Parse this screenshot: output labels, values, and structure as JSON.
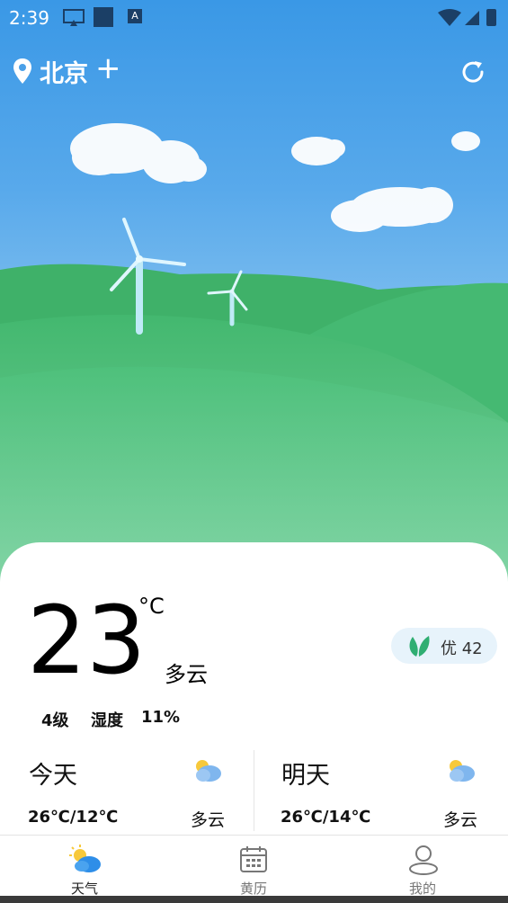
{
  "status_bar": {
    "time": "2:39"
  },
  "header": {
    "city": "北京",
    "add_symbol": "+"
  },
  "current": {
    "temperature": "23",
    "unit": "°C",
    "condition": "多云",
    "wind": "4级",
    "humidity_label": "湿度",
    "humidity_value": "11%",
    "aqi": "优 42"
  },
  "forecast": [
    {
      "day": "今天",
      "range": "26℃/12℃",
      "condition": "多云",
      "icon": "partly-cloudy-icon"
    },
    {
      "day": "明天",
      "range": "26℃/14℃",
      "condition": "多云",
      "icon": "partly-cloudy-icon"
    }
  ],
  "bottom_nav": [
    {
      "label": "天气",
      "icon": "weather-icon"
    },
    {
      "label": "黄历",
      "icon": "calendar-icon"
    },
    {
      "label": "我的",
      "icon": "profile-icon"
    }
  ],
  "colors": {
    "sky_top": "#3a98e6",
    "hill_green": "#4cc07e",
    "aqi_leaf": "#2fae72"
  }
}
